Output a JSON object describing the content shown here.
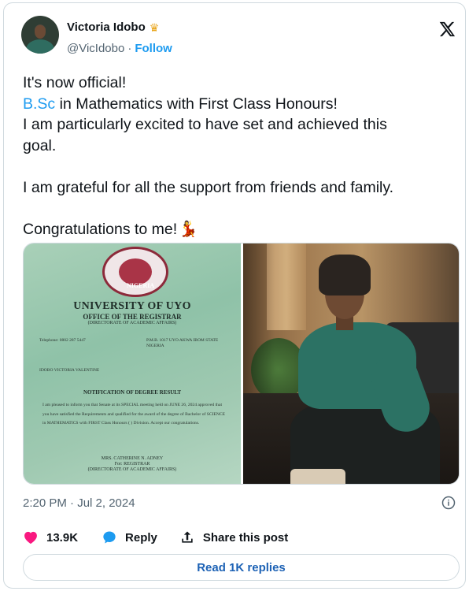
{
  "author": {
    "display_name": "Victoria Idobo",
    "handle": "@VicIdobo",
    "separator": "·",
    "follow_label": "Follow",
    "badge_icon": "crown-icon"
  },
  "tweet": {
    "lines": [
      {
        "text": "It's now official!"
      },
      {
        "hashtag": "B.Sc",
        "text": " in Mathematics with First Class Honours!"
      },
      {
        "text": "I am particularly excited to have set and achieved this"
      },
      {
        "text": "goal."
      },
      {
        "text": ""
      },
      {
        "text": "I am grateful for all the support from friends and family."
      },
      {
        "text": ""
      },
      {
        "text": "Congratulations to me!",
        "emoji": "💃"
      }
    ]
  },
  "media": {
    "document": {
      "seal_text": "NIGERIA",
      "title": "UNIVERSITY OF UYO",
      "subtitle": "OFFICE OF THE REGISTRAR",
      "directorate": "(DIRECTORATE OF ACADEMIC AFFAIRS)",
      "telephone": "Telephone: 0802 287 5447",
      "address": "P.M.B. 1017 UYO AKWA IBOM STATE NIGERIA",
      "recipient": "IDOBO VICTORIA VALENTINE",
      "heading": "NOTIFICATION OF DEGREE RESULT",
      "body": "I am pleased to inform you that Senate at its SPECIAL meeting held on JUNE 26, 2024 approved that you have satisfied the Requirements and qualified for the award of the degree of Bachelor of SCIENCE in MATHEMATICS with FIRST Class Honours ( ) Division. Accept our congratulations.",
      "signatory": "MRS. CATHERINE N. ADNEY",
      "for_registrar": "For: REGISTRAR",
      "sign_directorate": "(DIRECTORATE OF ACADEMIC AFFAIRS)"
    }
  },
  "meta": {
    "timestamp": "2:20 PM · Jul 2, 2024"
  },
  "actions": {
    "like_count": "13.9K",
    "reply_label": "Reply",
    "share_label": "Share this post",
    "read_replies_label": "Read 1K replies"
  },
  "colors": {
    "accent": "#1d9bf0",
    "like": "#f91880",
    "text": "#0f1419",
    "muted": "#536471",
    "border": "#cfd9de"
  }
}
